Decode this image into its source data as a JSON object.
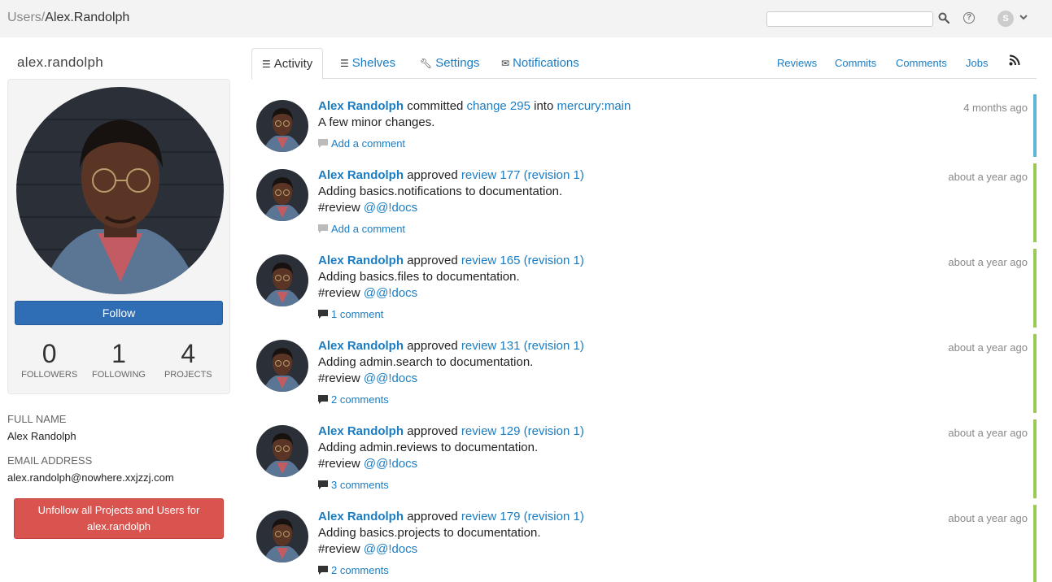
{
  "header": {
    "breadcrumb_parent": "Users/",
    "breadcrumb_current": "Alex.Randolph",
    "search": {
      "value": "",
      "placeholder": ""
    },
    "user_initial": "S"
  },
  "sidebar": {
    "username": "alex.randolph",
    "follow_label": "Follow",
    "stats": [
      {
        "value": "0",
        "label": "FOLLOWERS"
      },
      {
        "value": "1",
        "label": "FOLLOWING"
      },
      {
        "value": "4",
        "label": "PROJECTS"
      }
    ],
    "full_name_label": "FULL NAME",
    "full_name": "Alex Randolph",
    "email_label": "EMAIL ADDRESS",
    "email": "alex.randolph@nowhere.xxjzzj.com",
    "unfollow_line1": "Unfollow all Projects and Users for",
    "unfollow_line2": "alex.randolph"
  },
  "tabs": [
    {
      "label": "Activity",
      "icon": "list-icon",
      "active": true
    },
    {
      "label": "Shelves",
      "icon": "list-icon",
      "active": false
    },
    {
      "label": "Settings",
      "icon": "wrench-icon",
      "active": false
    },
    {
      "label": "Notifications",
      "icon": "envelope-icon",
      "active": false
    }
  ],
  "filters": [
    "Reviews",
    "Commits",
    "Comments",
    "Jobs"
  ],
  "colors": {
    "commit_bar": "#5fb5d6",
    "review_bar": "#9bc857",
    "link": "#1a7dc4",
    "follow": "#2f6db5",
    "unfollow": "#d9534f"
  },
  "activity": [
    {
      "author": "Alex Randolph",
      "verb": "committed",
      "target": "change 295",
      "connector": "into",
      "target2": "mercury:main",
      "description": "A few minor changes.",
      "tag": "",
      "mention": "",
      "comments": "Add a comment",
      "has_comments": false,
      "time": "4 months ago",
      "type": "commit"
    },
    {
      "author": "Alex Randolph",
      "verb": "approved",
      "target": "review 177 (revision 1)",
      "connector": "",
      "target2": "",
      "description": "Adding basics.notifications to documentation.",
      "tag": "#review",
      "mention": "@@!docs",
      "comments": "Add a comment",
      "has_comments": false,
      "time": "about a year ago",
      "type": "review"
    },
    {
      "author": "Alex Randolph",
      "verb": "approved",
      "target": "review 165 (revision 1)",
      "connector": "",
      "target2": "",
      "description": "Adding basics.files to documentation.",
      "tag": "#review",
      "mention": "@@!docs",
      "comments": "1 comment",
      "has_comments": true,
      "time": "about a year ago",
      "type": "review"
    },
    {
      "author": "Alex Randolph",
      "verb": "approved",
      "target": "review 131 (revision 1)",
      "connector": "",
      "target2": "",
      "description": "Adding admin.search to documentation.",
      "tag": "#review",
      "mention": "@@!docs",
      "comments": "2 comments",
      "has_comments": true,
      "time": "about a year ago",
      "type": "review"
    },
    {
      "author": "Alex Randolph",
      "verb": "approved",
      "target": "review 129 (revision 1)",
      "connector": "",
      "target2": "",
      "description": "Adding admin.reviews to documentation.",
      "tag": "#review",
      "mention": "@@!docs",
      "comments": "3 comments",
      "has_comments": true,
      "time": "about a year ago",
      "type": "review"
    },
    {
      "author": "Alex Randolph",
      "verb": "approved",
      "target": "review 179 (revision 1)",
      "connector": "",
      "target2": "",
      "description": "Adding basics.projects to documentation.",
      "tag": "#review",
      "mention": "@@!docs",
      "comments": "2 comments",
      "has_comments": true,
      "time": "about a year ago",
      "type": "review"
    }
  ]
}
